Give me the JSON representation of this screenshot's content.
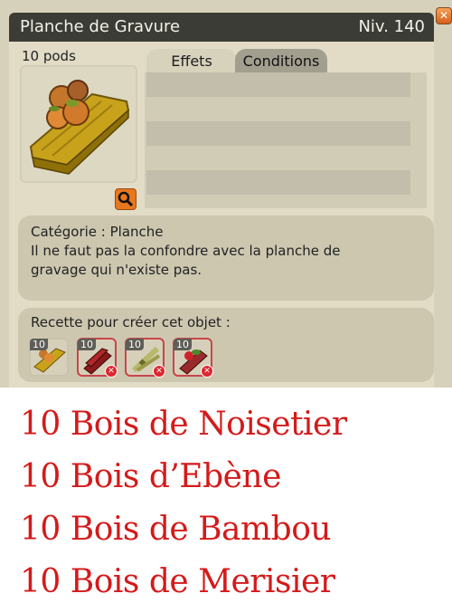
{
  "window": {
    "title": "Planche de Gravure",
    "level": "Niv. 140",
    "close_icon": "close-icon"
  },
  "item": {
    "weight": "10 pods",
    "image_icon": "planche-de-gravure-item-icon",
    "zoom_icon": "magnifier-icon"
  },
  "tabs": [
    {
      "label": "Effets",
      "active": true
    },
    {
      "label": "Conditions",
      "active": false
    }
  ],
  "description": {
    "category": "Catégorie : Planche",
    "text_line1": "Il ne faut pas la confondre avec la planche de",
    "text_line2": "gravage qui n'existe pas."
  },
  "recipe": {
    "title": "Recette pour créer cet objet :",
    "ingredients": [
      {
        "qty": "10",
        "icon": "bois-noisetier-icon",
        "missing": false
      },
      {
        "qty": "10",
        "icon": "bois-ebene-icon",
        "missing": true
      },
      {
        "qty": "10",
        "icon": "bois-bambou-icon",
        "missing": true
      },
      {
        "qty": "10",
        "icon": "bois-merisier-icon",
        "missing": true
      }
    ]
  },
  "ingredient_list": [
    "10 Bois de Noisetier",
    "10 Bois d’Ebène",
    "10 Bois de Bambou",
    "10 Bois de Merisier"
  ],
  "colors": {
    "titlebar": "#3c3c36",
    "panel": "#cdc7b0",
    "close_button": "#e8781e",
    "missing_border": "#c9454a",
    "list_text": "#d41a1a"
  }
}
